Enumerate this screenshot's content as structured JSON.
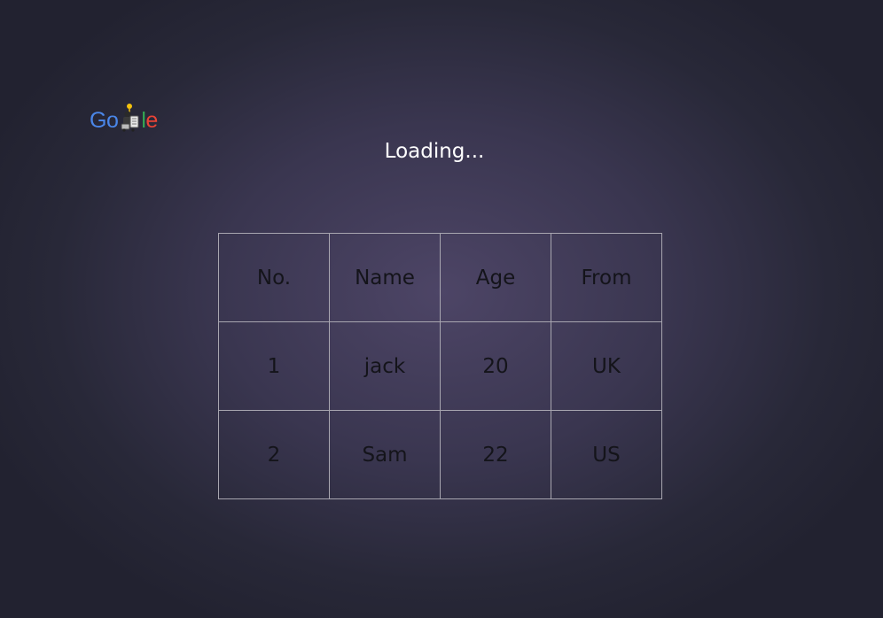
{
  "logo": {
    "letters": [
      "G",
      "o",
      "l",
      "e"
    ],
    "doodle_icon": "doodle-character-icon"
  },
  "status": {
    "loading_text": "Loading..."
  },
  "table": {
    "headers": [
      "No.",
      "Name",
      "Age",
      "From"
    ],
    "rows": [
      [
        "1",
        "jack",
        "20",
        "UK"
      ],
      [
        "2",
        "Sam",
        "22",
        "US"
      ]
    ]
  },
  "colors": {
    "logo_blue": "#4a86e8",
    "logo_green": "#34a853",
    "logo_red": "#ea4335",
    "table_border": "#a8a6b0",
    "table_text": "#14141a",
    "loading_text": "#ffffff"
  }
}
